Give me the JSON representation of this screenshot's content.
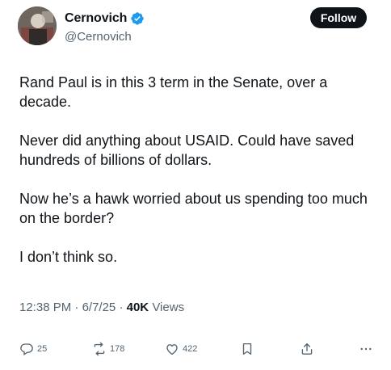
{
  "author": {
    "name": "Cernovich",
    "handle": "@Cernovich",
    "verified": true,
    "accent_color": "#1d9bf0"
  },
  "follow_label": "Follow",
  "tweet": {
    "paragraphs": [
      "Rand Paul is in this 3 term in the Senate, over a decade.",
      "Never did anything about USAID. Could have saved hundreds of billions of dollars.",
      "Now he’s a hawk worried about us spending too much on the border?",
      "I don’t think so."
    ]
  },
  "meta": {
    "time": "12:38 PM",
    "date": "6/7/25",
    "views_count": "40K",
    "views_label": "Views"
  },
  "actions": {
    "replies": "25",
    "reposts": "178",
    "likes": "422"
  },
  "icons": [
    "reply-icon",
    "repost-icon",
    "like-icon",
    "bookmark-icon",
    "share-icon",
    "more-icon",
    "verified-badge-icon"
  ]
}
